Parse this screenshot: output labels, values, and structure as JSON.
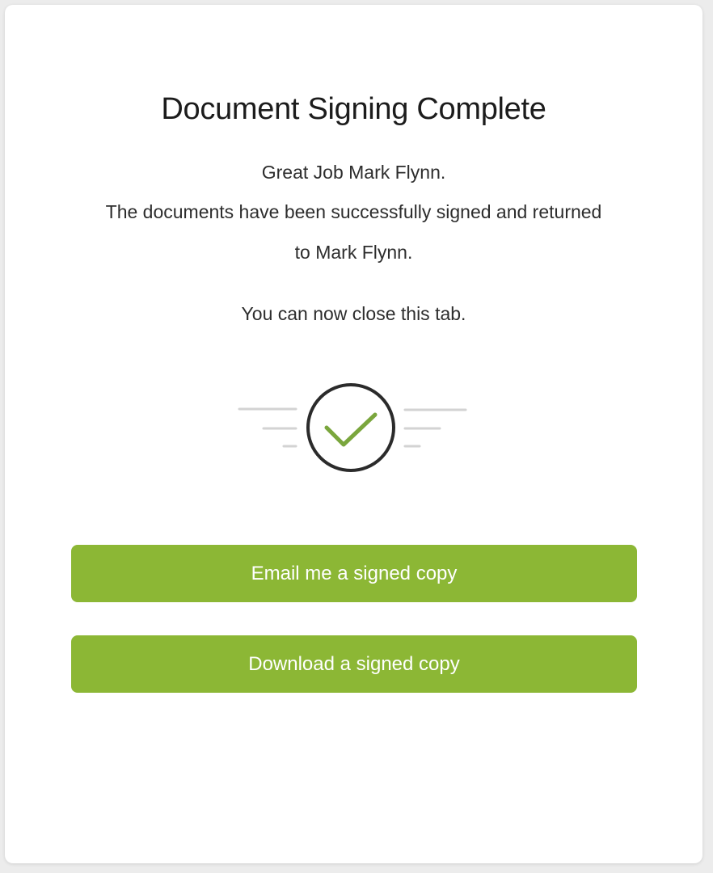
{
  "title": "Document Signing Complete",
  "messages": {
    "greeting": "Great Job Mark Flynn.",
    "line1": "The documents have been successfully signed and returned",
    "line2": "to Mark Flynn.",
    "close_tab": "You can now close this tab."
  },
  "icon": "check-circle-icon",
  "buttons": {
    "email": "Email me a signed copy",
    "download": "Download a signed copy"
  },
  "colors": {
    "accent": "#8cb735",
    "check": "#7aa63d",
    "circle": "#2b2b2b",
    "lines": "#d3d3d3"
  }
}
